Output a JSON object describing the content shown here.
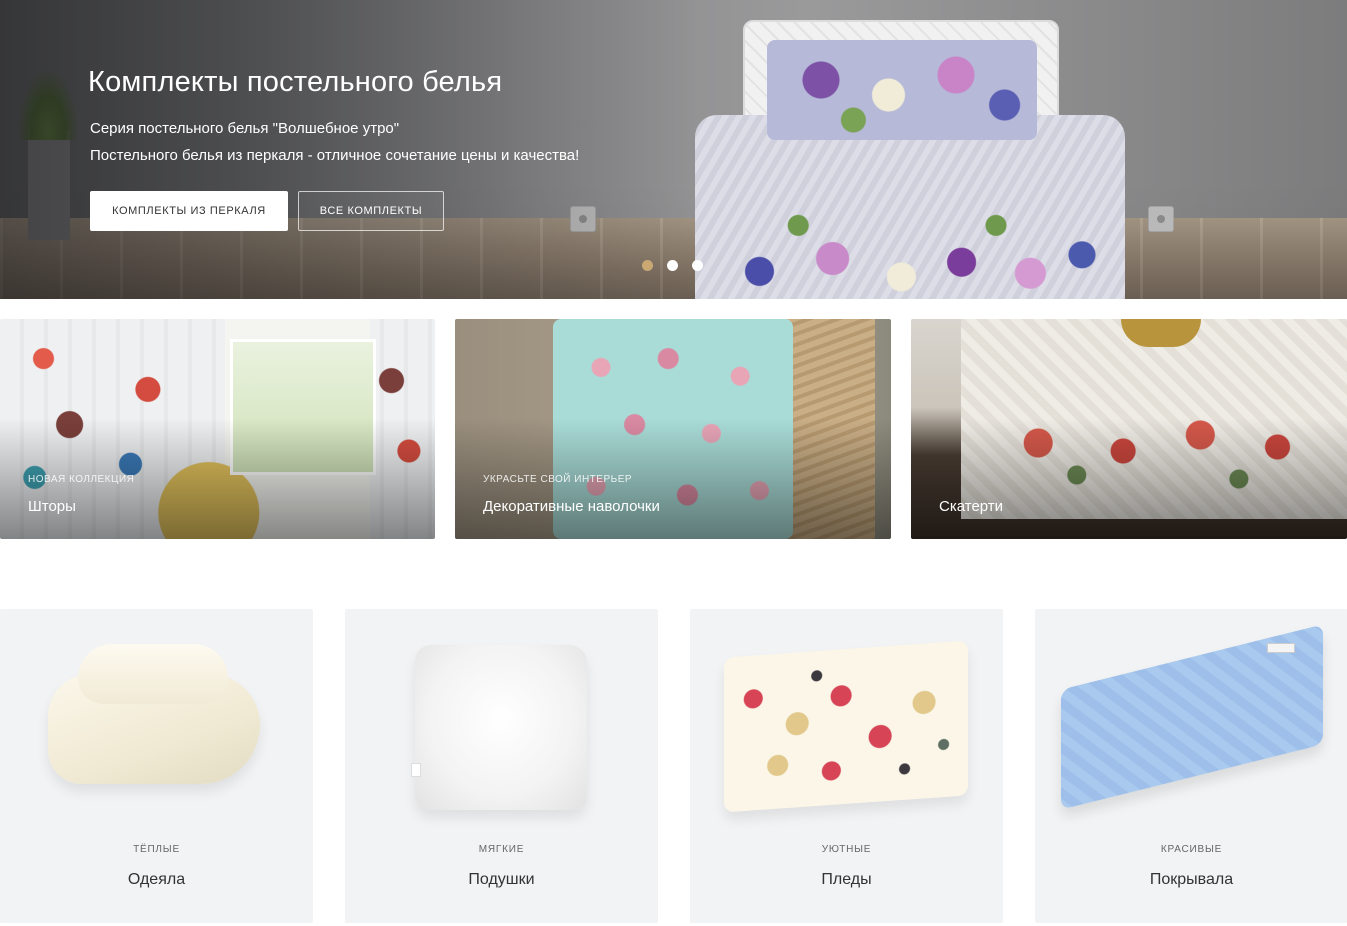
{
  "hero": {
    "title": "Комплекты постельного белья",
    "subtitle_line1": "Серия постельного белья \"Волшебное утро\"",
    "subtitle_line2": "Постельного белья из перкаля - отличное сочетание цены и качества!",
    "button_primary": "КОМПЛЕКТЫ ИЗ ПЕРКАЛЯ",
    "button_secondary": "ВСЕ КОМПЛЕКТЫ",
    "slides": 3,
    "active_slide": 1,
    "accent_color": "#c9a874"
  },
  "banners": [
    {
      "kicker": "НОВАЯ КОЛЛЕКЦИЯ",
      "title": "Шторы"
    },
    {
      "kicker": "УКРАСЬТЕ СВОЙ ИНТЕРЬЕР",
      "title": "Декоративные наволочки"
    },
    {
      "kicker": "",
      "title": "Скатерти"
    }
  ],
  "products": [
    {
      "kicker": "ТЁПЛЫЕ",
      "title": "Одеяла"
    },
    {
      "kicker": "МЯГКИЕ",
      "title": "Подушки"
    },
    {
      "kicker": "УЮТНЫЕ",
      "title": "Пледы"
    },
    {
      "kicker": "КРАСИВЫЕ",
      "title": "Покрывала"
    }
  ]
}
